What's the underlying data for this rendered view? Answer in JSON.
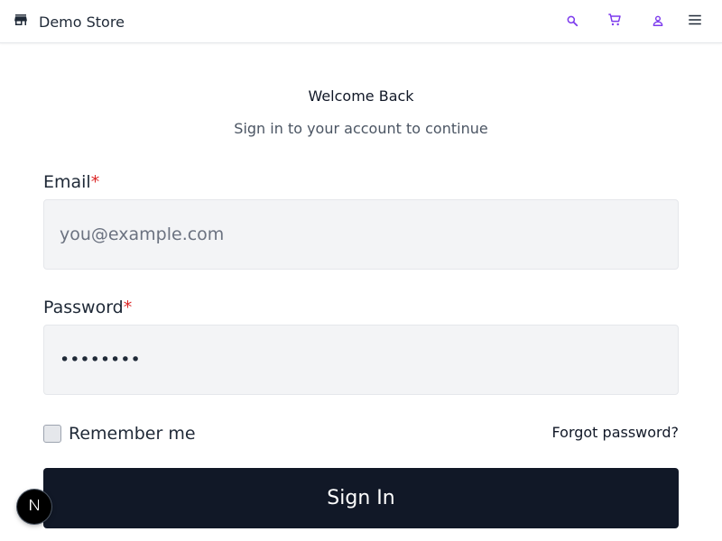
{
  "header": {
    "brand_label": "Demo Store",
    "icons": [
      "storefront-icon",
      "search-icon",
      "cart-icon",
      "user-icon",
      "menu-icon"
    ],
    "icon_color": "#7c3aed"
  },
  "login": {
    "title": "Welcome Back",
    "subtitle": "Sign in to your account to continue",
    "email": {
      "label": "Email",
      "required_mark": "*",
      "placeholder": "you@example.com",
      "value": ""
    },
    "password": {
      "label": "Password",
      "required_mark": "*",
      "value": "password"
    },
    "remember_label": "Remember me",
    "remember_checked": false,
    "forgot_label": "Forgot password?",
    "submit_label": "Sign In"
  },
  "dev_badge": {
    "letter": "N"
  },
  "colors": {
    "button_bg": "#111827",
    "required": "#dc2626",
    "input_bg": "#f3f4f6"
  }
}
